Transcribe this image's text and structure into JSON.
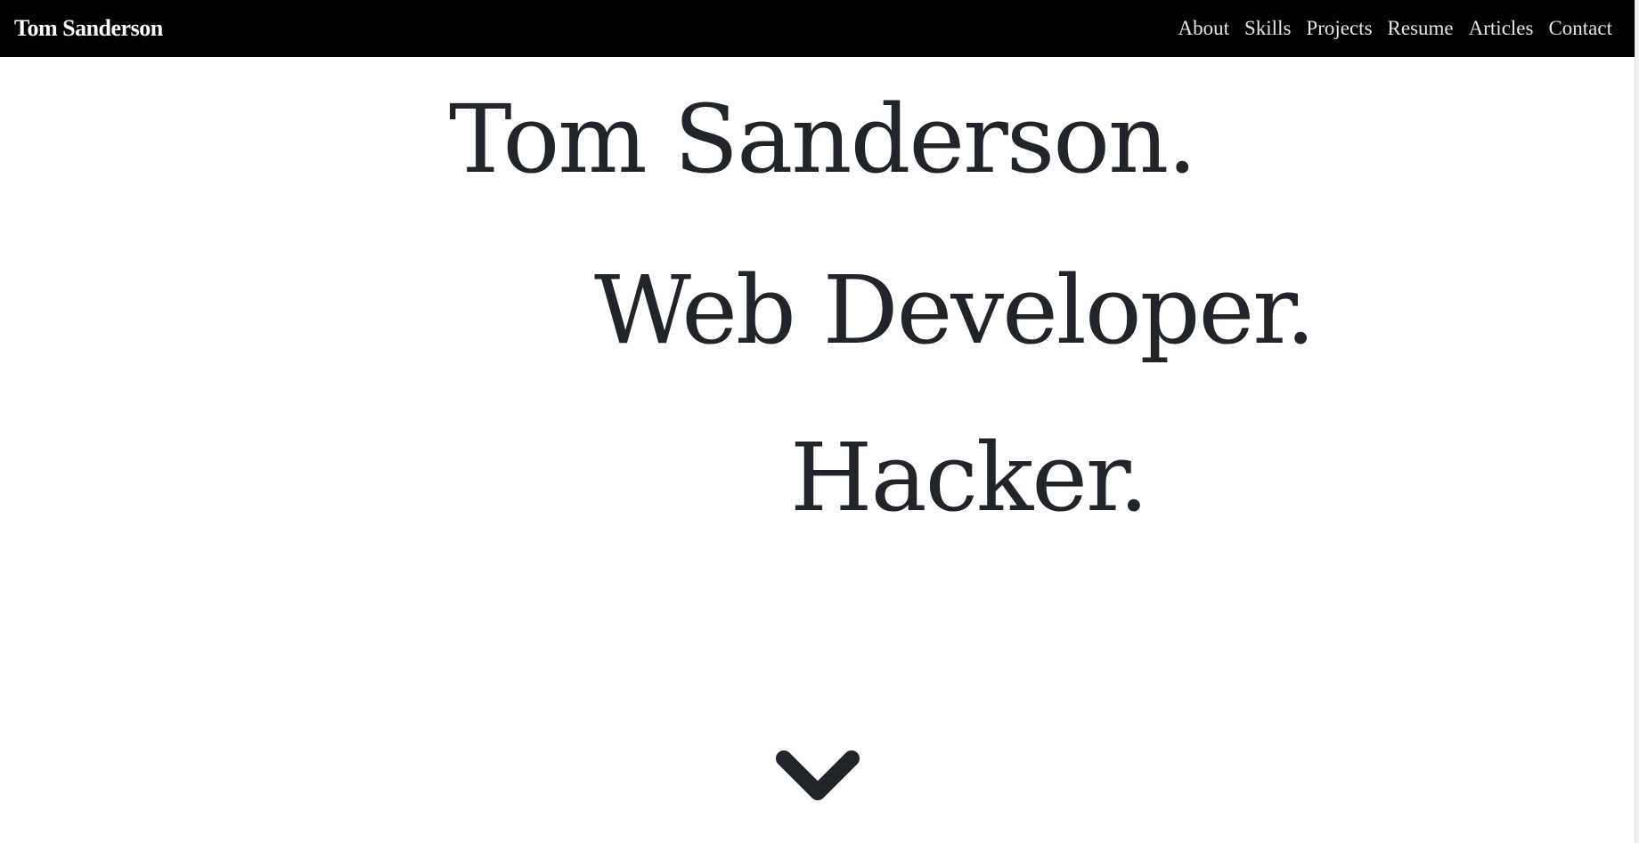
{
  "nav": {
    "brand": "Tom Sanderson",
    "links": [
      "About",
      "Skills",
      "Projects",
      "Resume",
      "Articles",
      "Contact"
    ]
  },
  "hero": {
    "lines": [
      "Tom Sanderson.",
      "Web Developer.",
      "Hacker."
    ]
  },
  "icons": {
    "scroll_down": "chevron-down-icon"
  },
  "colors": {
    "navbar_bg": "#000000",
    "brand_text": "#ffffff",
    "nav_text": "#e6e6e6",
    "hero_text": "#212529",
    "page_bg": "#ffffff"
  }
}
